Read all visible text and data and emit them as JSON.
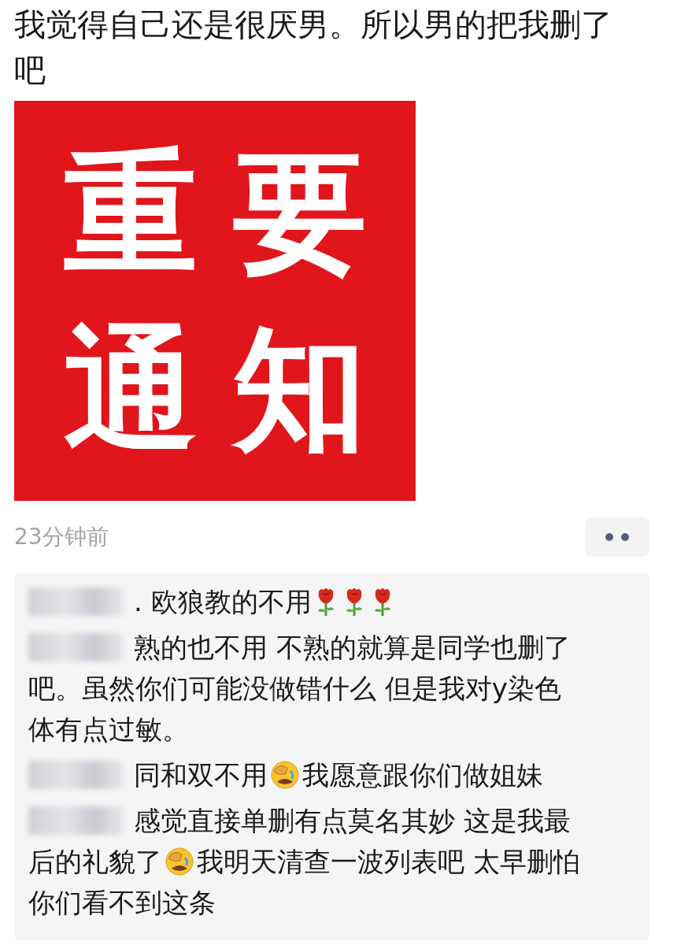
{
  "post": {
    "text": "我觉得自己还是很厌男。所以男的把我删了吧",
    "image": {
      "kind": "poster",
      "chars": [
        "重",
        "要",
        "通",
        "知"
      ]
    },
    "time": "23分钟前"
  },
  "comments": [
    {
      "lines": [
        [
          {
            "kind": "text",
            "text": ". 欧狼教的不用"
          },
          {
            "kind": "rose"
          },
          {
            "kind": "rose"
          },
          {
            "kind": "rose"
          }
        ]
      ]
    },
    {
      "lines": [
        [
          {
            "kind": "text",
            "text": "熟的也不用 不熟的就算是同学也删了"
          }
        ],
        [
          {
            "kind": "text",
            "text": "吧。虽然你们可能没做错什么 但是我对y染色"
          }
        ],
        [
          {
            "kind": "text",
            "text": "体有点过敏。"
          }
        ]
      ]
    },
    {
      "lines": [
        [
          {
            "kind": "text",
            "text": "同和双不用"
          },
          {
            "kind": "facepalm"
          },
          {
            "kind": "text",
            "text": "我愿意跟你们做姐妹"
          }
        ]
      ]
    },
    {
      "lines": [
        [
          {
            "kind": "text",
            "text": "感觉直接单删有点莫名其妙 这是我最"
          }
        ],
        [
          {
            "kind": "text",
            "text": "后的礼貌了"
          },
          {
            "kind": "facepalm"
          },
          {
            "kind": "text",
            "text": "我明天清查一波列表吧 太早删怕"
          }
        ],
        [
          {
            "kind": "text",
            "text": "你们看不到这条"
          }
        ]
      ]
    }
  ]
}
